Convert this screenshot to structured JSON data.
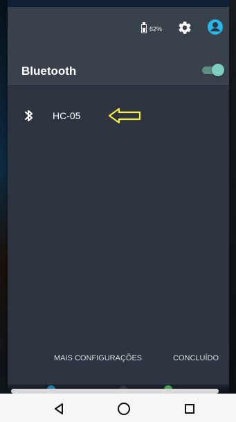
{
  "status": {
    "battery_percent": "62%",
    "icons": [
      "battery-icon",
      "gear-icon",
      "account-icon"
    ]
  },
  "bluetooth": {
    "title": "Bluetooth",
    "enabled": true,
    "devices": [
      {
        "name": "HC-05",
        "icon": "bluetooth-icon",
        "highlight_icon": "arrow-left-icon"
      }
    ]
  },
  "actions": {
    "more_settings": "MAIS CONFIGURAÇÕES",
    "done": "CONCLUÍDO"
  },
  "navigation": {
    "back_icon": "back-icon",
    "home_icon": "home-icon",
    "recent_icon": "recent-apps-icon"
  },
  "colors": {
    "panel": "#2d3440",
    "header": "#39414a",
    "toggle_accent": "#7fcfc0",
    "arrow": "#f3ea3a",
    "account": "#25b8e8"
  }
}
